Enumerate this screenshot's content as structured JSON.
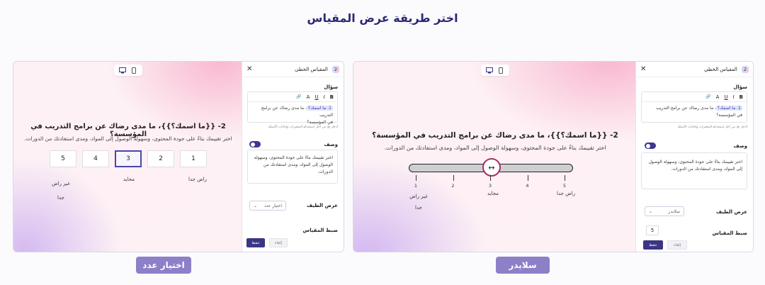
{
  "page_title": "اختر طريقة عرض المقياس",
  "question_text": "2- {{ما اسمك؟}}، ما مدى رضاك عن برامج التدريب في المؤسسة؟",
  "question_desc": "اختر تقييمك بناءً على جودة المحتوى، وسهولة الوصول إلى المواد، ومدى استفادتك من الدورات.",
  "scale_numbers": [
    "1",
    "2",
    "3",
    "4",
    "5"
  ],
  "selected_value": "3",
  "slider_value": 3,
  "scale_labels": {
    "low": "غير راض جدا",
    "low_line1": "غير راض",
    "low_line2": "جدا",
    "mid": "محايد",
    "high": "راض جدا"
  },
  "slider_arrow": "↔",
  "panel": {
    "title": "المقياس الخطي",
    "badge": "2",
    "close": "✕",
    "question_label": "سؤال",
    "editor_line1_var": "1. ما اسمك؟",
    "editor_line1_rest": "، ما مدى رضاك عن برامج التدريب",
    "editor_line2": "في المؤسسة؟",
    "hint": "أدخل @ من أجل استخدام المتغيرات وإجابات الأسئلة",
    "toolbar": [
      "B",
      "I",
      "U",
      "A",
      "🔗"
    ],
    "desc_label": "وصف",
    "desc_text": "اختر تقييمك بناءً على جودة المحتوى، وسهولة الوصول إلى المواد، ومدى استفادتك من الدورات.",
    "range_label": "عرض الطيف",
    "scale_label": "ضبط المقياس",
    "scale_value": "5",
    "save": "حفظ",
    "cancel": "إلغاء"
  },
  "left_card": {
    "select_value": "اختيار عدد"
  },
  "right_card": {
    "select_value": "سلايدر"
  },
  "captions": {
    "left": "اختيار عدد",
    "right": "سلايدر"
  },
  "colors": {
    "accent": "#3d3790",
    "caption_bg": "#8d80c8",
    "title": "#2c2776"
  }
}
